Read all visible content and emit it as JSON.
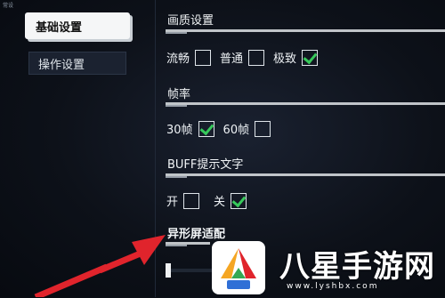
{
  "corner_label": "常设",
  "tabs": [
    {
      "label": "基础设置",
      "active": true
    },
    {
      "label": "操作设置",
      "active": false
    }
  ],
  "sections": {
    "quality": {
      "title": "画质设置",
      "options": [
        {
          "label": "流畅",
          "checked": false
        },
        {
          "label": "普通",
          "checked": false
        },
        {
          "label": "极致",
          "checked": true
        }
      ]
    },
    "framerate": {
      "title": "帧率",
      "options": [
        {
          "label": "30帧",
          "checked": true
        },
        {
          "label": "60帧",
          "checked": false
        }
      ]
    },
    "buff": {
      "title": "BUFF提示文字",
      "options": [
        {
          "label": "开",
          "checked": false
        },
        {
          "label": "关",
          "checked": true
        }
      ]
    },
    "notch": {
      "title": "异形屏适配",
      "slider_level": 0.0
    }
  },
  "colors": {
    "accent_check": "#37c95b",
    "arrow": "#e0242c"
  },
  "watermark": {
    "title": "八星手游网",
    "url": "www.lyshbx.com"
  }
}
